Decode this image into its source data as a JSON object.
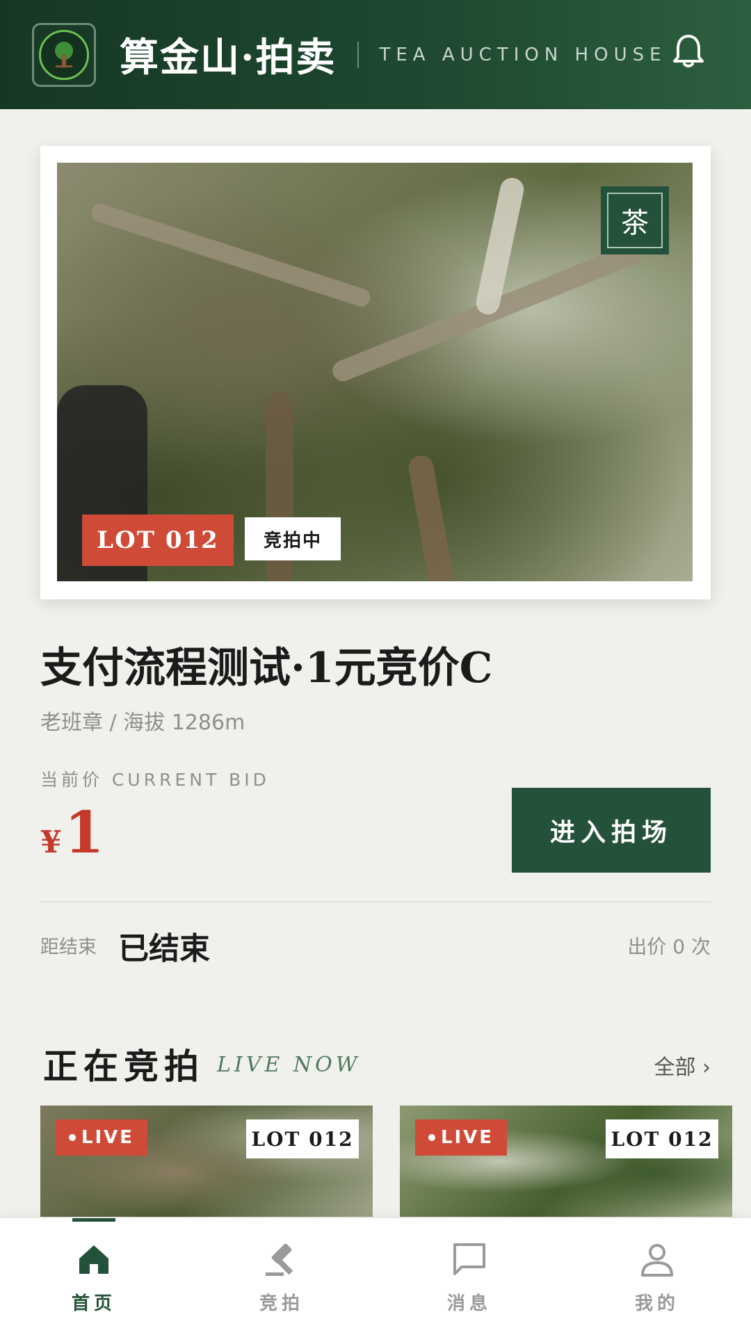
{
  "header": {
    "brand": "算金山·拍卖",
    "tagline": "TEA AUCTION HOUSE"
  },
  "hero": {
    "tea_badge": "茶",
    "lot": "LOT 012",
    "status": "竞拍中"
  },
  "item": {
    "title": "支付流程测试·1元竞价C",
    "meta": "老班章 / 海拔 1286m",
    "bid_label": "当前价 CURRENT BID",
    "currency": "¥",
    "price": "1",
    "enter_button": "进入拍场",
    "end_label": "距结束",
    "end_value": "已结束",
    "bid_count": "出价 0 次"
  },
  "live_section": {
    "title": "正在竞拍",
    "subtitle": "LIVE NOW",
    "all_link": "全部 ›",
    "cards": [
      {
        "live": "LIVE",
        "lot": "LOT 012"
      },
      {
        "live": "LIVE",
        "lot": "LOT 012"
      }
    ]
  },
  "nav": {
    "items": [
      {
        "label": "首页",
        "icon": "home-icon"
      },
      {
        "label": "竞拍",
        "icon": "gavel-icon"
      },
      {
        "label": "消息",
        "icon": "message-icon"
      },
      {
        "label": "我的",
        "icon": "profile-icon"
      }
    ],
    "active_index": 0
  },
  "colors": {
    "primary": "#24513a",
    "accent": "#cf4b38",
    "background": "#f0f0ec"
  }
}
